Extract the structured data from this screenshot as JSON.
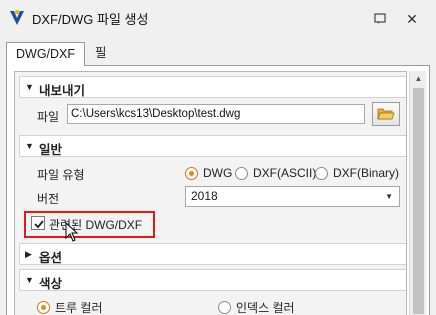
{
  "window": {
    "title": "DXF/DWG 파일 생성",
    "help_icon": "help-icon",
    "close_glyph": "✕"
  },
  "tabs": [
    {
      "label": "DWG/DXF",
      "active": true
    },
    {
      "label": "필터",
      "active": false
    }
  ],
  "export_section": {
    "title": "내보내기",
    "file_label": "파일",
    "file_path": "C:\\Users\\kcs13\\Desktop\\test.dwg",
    "browse_icon": "folder-icon"
  },
  "general_section": {
    "title": "일반",
    "file_type_label": "파일 유형",
    "file_types": [
      "DWG",
      "DXF(ASCII)",
      "DXF(Binary)"
    ],
    "selected_file_type": "DWG",
    "version_label": "버전",
    "version_value": "2018",
    "related_checkbox_label": "관련된 DWG/DXF",
    "related_checked": true
  },
  "options_section": {
    "title": "옵션"
  },
  "color_section": {
    "title": "색상",
    "options": [
      "트루 컬러",
      "인덱스 컬러"
    ],
    "selected": "트루 컬러"
  },
  "colors": {
    "accent": "#e08a1a",
    "highlight": "#e01b1b"
  }
}
